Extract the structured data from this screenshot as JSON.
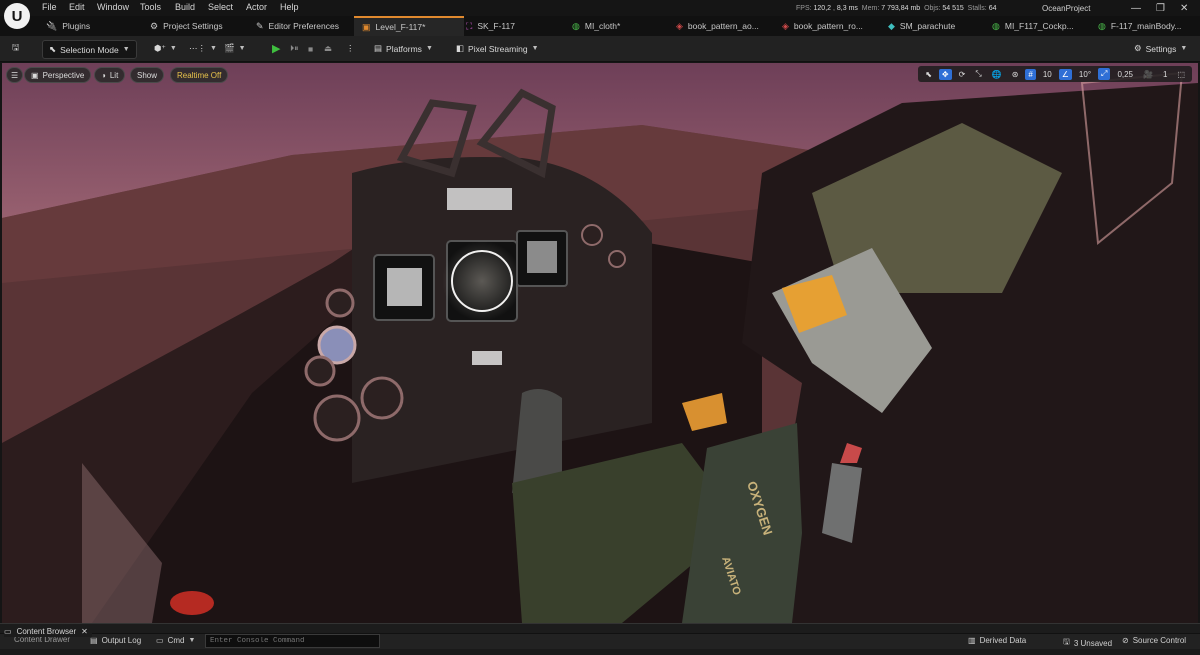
{
  "app": {
    "logo": "unreal-logo",
    "project_name": "OceanProject"
  },
  "menu": [
    "File",
    "Edit",
    "Window",
    "Tools",
    "Build",
    "Select",
    "Actor",
    "Help"
  ],
  "stats": {
    "fps_label": "FPS:",
    "fps_value": "120,2",
    "frame_ms": "8,3 ms",
    "mem_label": "Mem:",
    "mem_value": "7 793,84 mb",
    "objs_label": "Objs:",
    "objs_value": "54 515",
    "stalls_label": "Stalls:",
    "stalls_value": "64"
  },
  "tabs": [
    {
      "label": "Plugins",
      "icon": "plugin-icon"
    },
    {
      "label": "Project Settings",
      "icon": "settings-icon"
    },
    {
      "label": "Editor Preferences",
      "icon": "preferences-icon"
    },
    {
      "label": "Level_F-117*",
      "icon": "level-icon",
      "active": true
    },
    {
      "label": "SK_F-117",
      "icon": "skeletal-mesh-icon"
    },
    {
      "label": "MI_cloth*",
      "icon": "material-instance-icon"
    },
    {
      "label": "book_pattern_ao...",
      "icon": "texture-icon"
    },
    {
      "label": "book_pattern_ro...",
      "icon": "texture-icon"
    },
    {
      "label": "SM_parachute",
      "icon": "static-mesh-icon"
    },
    {
      "label": "MI_F117_Cockp...",
      "icon": "material-instance-icon"
    },
    {
      "label": "F-117_mainBody...",
      "icon": "material-instance-icon"
    }
  ],
  "toolbar": {
    "selection_mode": "Selection Mode",
    "platforms": "Platforms",
    "pixel_streaming": "Pixel Streaming",
    "settings": "Settings"
  },
  "viewport": {
    "perspective": "Perspective",
    "lit": "Lit",
    "show": "Show",
    "realtime": "Realtime Off",
    "grid_snap": "10",
    "rotation_snap": "10°",
    "scale_snap": "0,25",
    "camera_speed": "1"
  },
  "scene_text": {
    "oxygen": "OXYGEN",
    "aviator": "AVIATO"
  },
  "bottom": {
    "content_browser": "Content Browser",
    "content_drawer": "Content Drawer",
    "output_log": "Output Log",
    "cmd": "Cmd",
    "console_placeholder": "Enter Console Command",
    "derived_data": "Derived Data",
    "unsaved": "3 Unsaved",
    "source_control": "Source Control"
  },
  "colors": {
    "accent": "#e0892e",
    "active_blue": "#2f6fd6",
    "realtime": "#e7c24b",
    "play_green": "#3fbf3f"
  }
}
